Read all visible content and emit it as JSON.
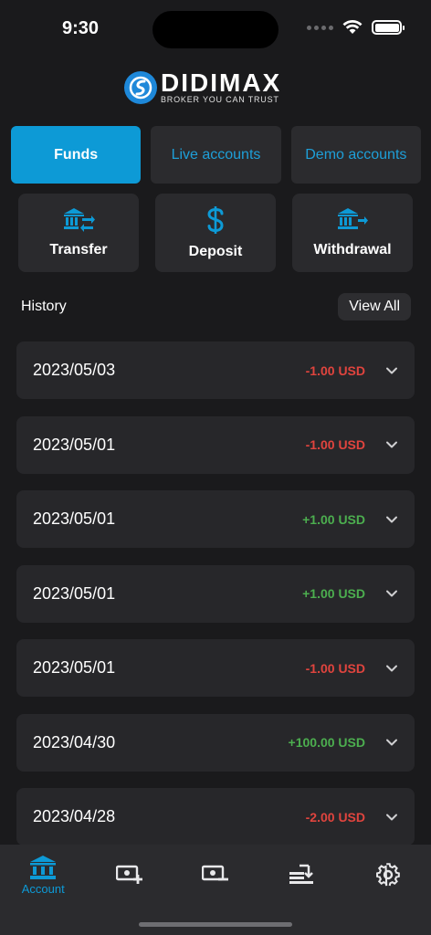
{
  "status": {
    "time": "9:30"
  },
  "brand": {
    "name": "DIDIMAX",
    "tagline": "BROKER YOU CAN TRUST",
    "accent": "#0d9ad6"
  },
  "tabs": [
    {
      "label": "Funds",
      "active": true
    },
    {
      "label": "Live accounts",
      "active": false
    },
    {
      "label": "Demo accounts",
      "active": false
    }
  ],
  "actions": [
    {
      "label": "Transfer",
      "icon": "bank-transfer-icon"
    },
    {
      "label": "Deposit",
      "icon": "dollar-icon"
    },
    {
      "label": "Withdrawal",
      "icon": "bank-withdraw-icon"
    }
  ],
  "history": {
    "title": "History",
    "view_all_label": "View All",
    "rows": [
      {
        "date": "2023/05/03",
        "amount": "-1.00 USD",
        "sign": "neg"
      },
      {
        "date": "2023/05/01",
        "amount": "-1.00 USD",
        "sign": "neg"
      },
      {
        "date": "2023/05/01",
        "amount": "+1.00 USD",
        "sign": "pos"
      },
      {
        "date": "2023/05/01",
        "amount": "+1.00 USD",
        "sign": "pos"
      },
      {
        "date": "2023/05/01",
        "amount": "-1.00 USD",
        "sign": "neg"
      },
      {
        "date": "2023/04/30",
        "amount": "+100.00 USD",
        "sign": "pos"
      },
      {
        "date": "2023/04/28",
        "amount": "-2.00 USD",
        "sign": "neg"
      }
    ]
  },
  "tabbar": {
    "items": [
      {
        "label": "Account",
        "icon": "bank-icon",
        "active": true
      },
      {
        "label": "",
        "icon": "deposit-money-icon",
        "active": false
      },
      {
        "label": "",
        "icon": "withdraw-money-icon",
        "active": false
      },
      {
        "label": "",
        "icon": "transfer-icon",
        "active": false
      },
      {
        "label": "",
        "icon": "gear-icon",
        "active": false
      }
    ]
  }
}
